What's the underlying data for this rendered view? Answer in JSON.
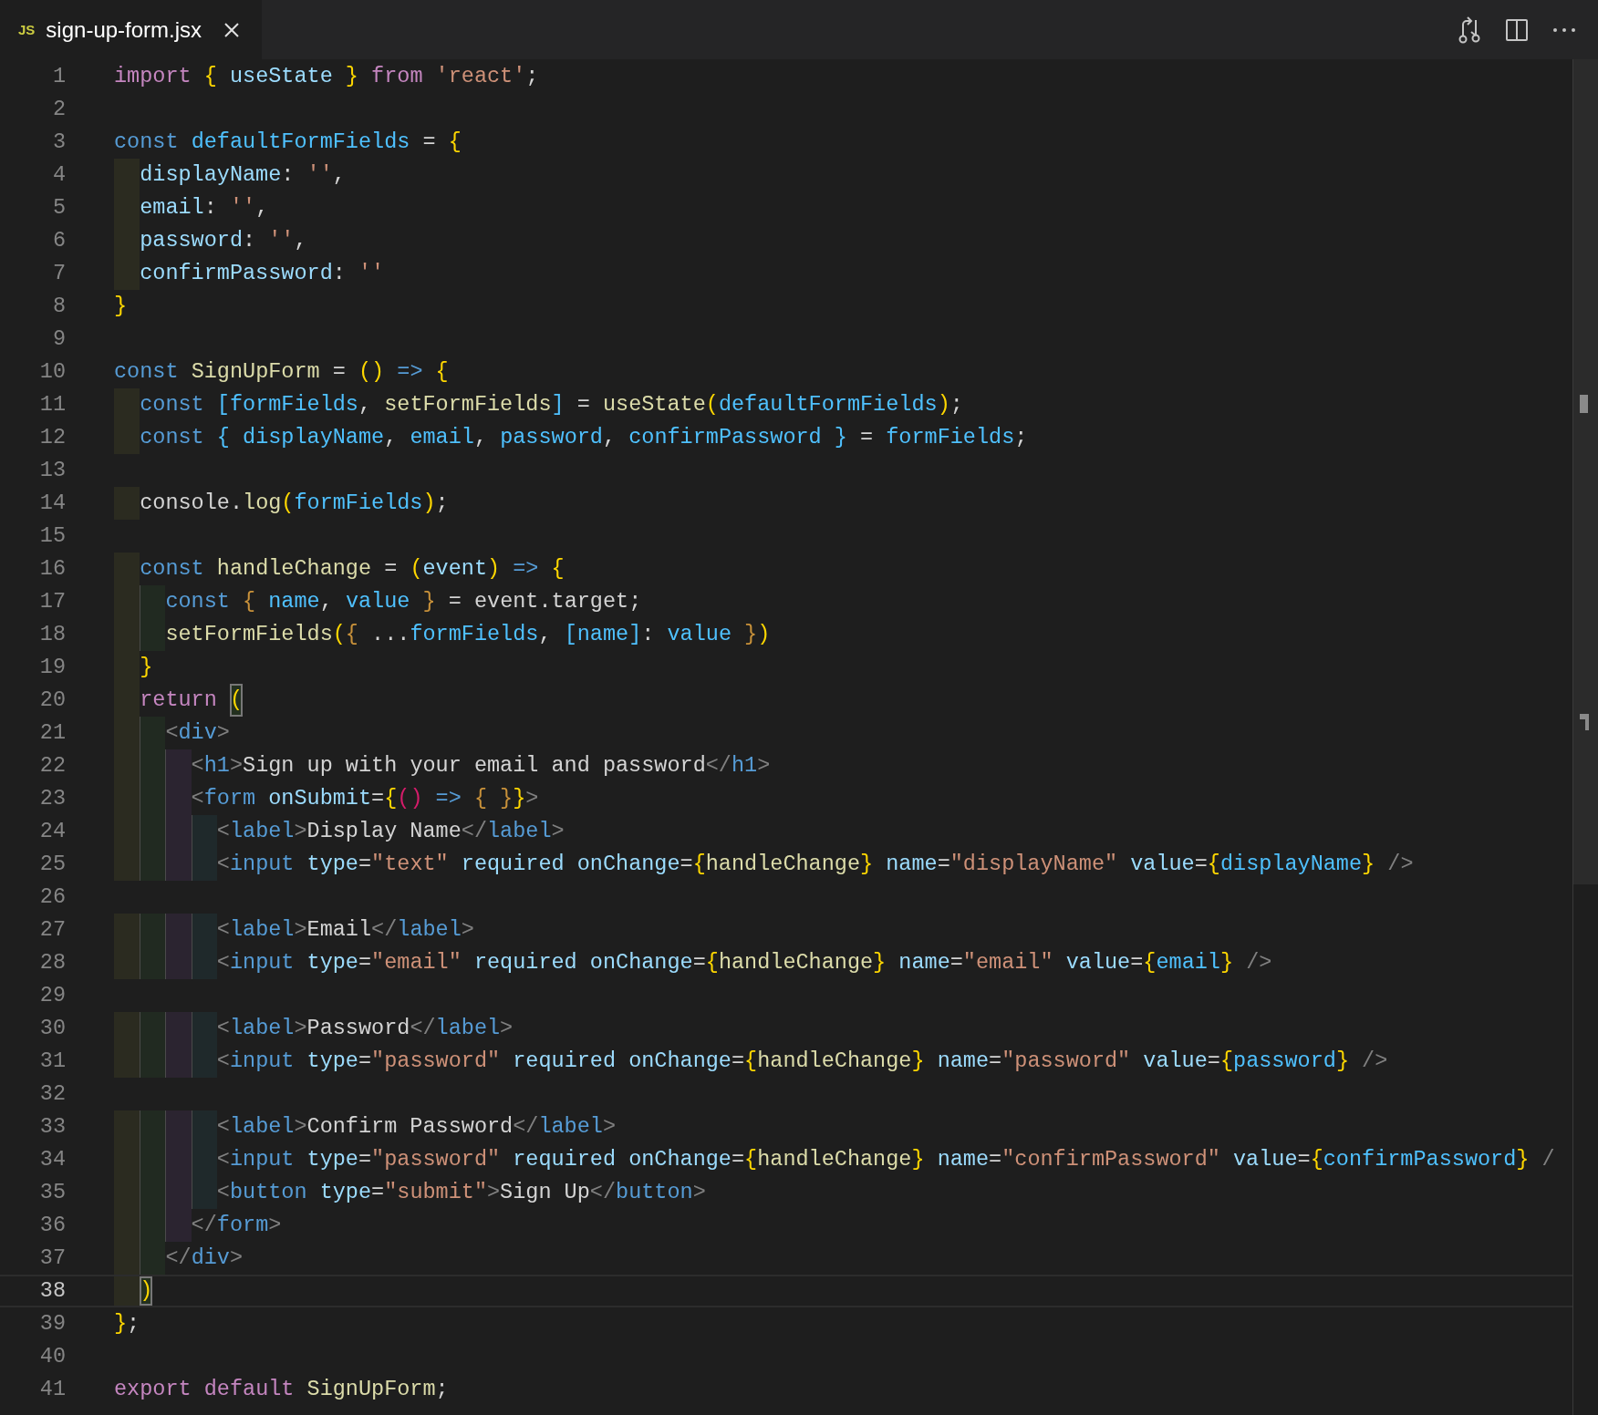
{
  "tab": {
    "icon_text": "JS",
    "label": "sign-up-form.jsx",
    "selected": true
  },
  "lines": [
    {
      "number": "1",
      "current": false,
      "tokens": [
        {
          "kind": "kw",
          "text": "import "
        },
        {
          "kind": "b1",
          "text": "{ "
        },
        {
          "kind": "var",
          "text": "useState "
        },
        {
          "kind": "b1",
          "text": "} "
        },
        {
          "kind": "kw",
          "text": "from "
        },
        {
          "kind": "str",
          "text": "'react'"
        },
        {
          "kind": "p",
          "text": ";"
        }
      ]
    },
    {
      "number": "2",
      "current": false
    },
    {
      "number": "3",
      "current": false,
      "tokens": [
        {
          "kind": "st",
          "text": "const "
        },
        {
          "kind": "const",
          "text": "defaultFormFields "
        },
        {
          "kind": "p",
          "text": "= "
        },
        {
          "kind": "b1",
          "text": "{"
        }
      ]
    },
    {
      "number": "4",
      "current": false,
      "tokens": [
        {
          "kind": "var",
          "text": "  displayName"
        },
        {
          "kind": "p",
          "text": ": "
        },
        {
          "kind": "str",
          "text": "''"
        },
        {
          "kind": "p",
          "text": ","
        }
      ]
    },
    {
      "number": "5",
      "current": false,
      "tokens": [
        {
          "kind": "var",
          "text": "  email"
        },
        {
          "kind": "p",
          "text": ": "
        },
        {
          "kind": "str",
          "text": "''"
        },
        {
          "kind": "p",
          "text": ","
        }
      ]
    },
    {
      "number": "6",
      "current": false,
      "tokens": [
        {
          "kind": "var",
          "text": "  password"
        },
        {
          "kind": "p",
          "text": ": "
        },
        {
          "kind": "str",
          "text": "''"
        },
        {
          "kind": "p",
          "text": ","
        }
      ]
    },
    {
      "number": "7",
      "current": false,
      "tokens": [
        {
          "kind": "var",
          "text": "  confirmPassword"
        },
        {
          "kind": "p",
          "text": ": "
        },
        {
          "kind": "str",
          "text": "''"
        }
      ]
    },
    {
      "number": "8",
      "current": false,
      "tokens": [
        {
          "kind": "b1",
          "text": "}"
        }
      ]
    },
    {
      "number": "9",
      "current": false
    },
    {
      "number": "10",
      "current": false,
      "tokens": [
        {
          "kind": "st",
          "text": "const "
        },
        {
          "kind": "fn",
          "text": "SignUpForm "
        },
        {
          "kind": "p",
          "text": "= "
        },
        {
          "kind": "b1",
          "text": "() "
        },
        {
          "kind": "st",
          "text": "=> "
        },
        {
          "kind": "b1",
          "text": "{"
        }
      ]
    },
    {
      "number": "11",
      "current": false,
      "tokens": [
        {
          "kind": "st",
          "text": "  const "
        },
        {
          "kind": "const",
          "text": "[formFields"
        },
        {
          "kind": "p",
          "text": ", "
        },
        {
          "kind": "fn",
          "text": "setFormFields"
        },
        {
          "kind": "const",
          "text": "]"
        },
        {
          "kind": "p",
          "text": " = "
        },
        {
          "kind": "fn",
          "text": "useState"
        },
        {
          "kind": "b1",
          "text": "("
        },
        {
          "kind": "const",
          "text": "defaultFormFields"
        },
        {
          "kind": "b1",
          "text": ")"
        },
        {
          "kind": "p",
          "text": ";"
        }
      ]
    },
    {
      "number": "12",
      "current": false,
      "tokens": [
        {
          "kind": "st",
          "text": "  const "
        },
        {
          "kind": "const",
          "text": "{ displayName"
        },
        {
          "kind": "p",
          "text": ", "
        },
        {
          "kind": "const",
          "text": "email"
        },
        {
          "kind": "p",
          "text": ", "
        },
        {
          "kind": "const",
          "text": "password"
        },
        {
          "kind": "p",
          "text": ", "
        },
        {
          "kind": "const",
          "text": "confirmPassword }"
        },
        {
          "kind": "p",
          "text": " = "
        },
        {
          "kind": "const",
          "text": "formFields"
        },
        {
          "kind": "p",
          "text": ";"
        }
      ]
    },
    {
      "number": "13",
      "current": false
    },
    {
      "number": "14",
      "current": false,
      "tokens": [
        {
          "kind": "p",
          "text": "  console."
        },
        {
          "kind": "fn",
          "text": "log"
        },
        {
          "kind": "b1",
          "text": "("
        },
        {
          "kind": "const",
          "text": "formFields"
        },
        {
          "kind": "b1",
          "text": ")"
        },
        {
          "kind": "p",
          "text": ";"
        }
      ]
    },
    {
      "number": "15",
      "current": false
    },
    {
      "number": "16",
      "current": false,
      "tokens": [
        {
          "kind": "st",
          "text": "  const "
        },
        {
          "kind": "fn",
          "text": "handleChange "
        },
        {
          "kind": "p",
          "text": "= "
        },
        {
          "kind": "b1",
          "text": "("
        },
        {
          "kind": "var",
          "text": "event"
        },
        {
          "kind": "b1",
          "text": ") "
        },
        {
          "kind": "st",
          "text": "=> "
        },
        {
          "kind": "b1",
          "text": "{"
        }
      ]
    },
    {
      "number": "17",
      "current": false,
      "tokens": [
        {
          "kind": "st",
          "text": "    const "
        },
        {
          "kind": "b3",
          "text": "{ "
        },
        {
          "kind": "const",
          "text": "name"
        },
        {
          "kind": "p",
          "text": ", "
        },
        {
          "kind": "const",
          "text": "value "
        },
        {
          "kind": "b3",
          "text": "}"
        },
        {
          "kind": "p",
          "text": " = event.target;"
        }
      ]
    },
    {
      "number": "18",
      "current": false,
      "tokens": [
        {
          "kind": "fn",
          "text": "    setFormFields"
        },
        {
          "kind": "b1",
          "text": "("
        },
        {
          "kind": "b3",
          "text": "{ "
        },
        {
          "kind": "p",
          "text": "..."
        },
        {
          "kind": "const",
          "text": "formFields"
        },
        {
          "kind": "p",
          "text": ", "
        },
        {
          "kind": "const",
          "text": "[name]"
        },
        {
          "kind": "p",
          "text": ": "
        },
        {
          "kind": "const",
          "text": "value "
        },
        {
          "kind": "b3",
          "text": "}"
        },
        {
          "kind": "b1",
          "text": ")"
        }
      ]
    },
    {
      "number": "19",
      "current": false,
      "tokens": [
        {
          "kind": "b1",
          "text": "  }"
        }
      ]
    },
    {
      "number": "20",
      "current": false,
      "tokens": [
        {
          "kind": "kw",
          "text": "  return "
        },
        {
          "kind": "b1",
          "text": "(",
          "matched": true
        }
      ]
    },
    {
      "number": "21",
      "current": false,
      "tokens": [
        {
          "kind": "tp",
          "text": "    <"
        },
        {
          "kind": "tag",
          "text": "div"
        },
        {
          "kind": "tp",
          "text": ">"
        }
      ]
    },
    {
      "number": "22",
      "current": false,
      "tokens": [
        {
          "kind": "tp",
          "text": "      <"
        },
        {
          "kind": "tag",
          "text": "h1"
        },
        {
          "kind": "tp",
          "text": ">"
        },
        {
          "kind": "p",
          "text": "Sign up with your email and password"
        },
        {
          "kind": "tp",
          "text": "</"
        },
        {
          "kind": "tag",
          "text": "h1"
        },
        {
          "kind": "tp",
          "text": ">"
        }
      ]
    },
    {
      "number": "23",
      "current": false,
      "tokens": [
        {
          "kind": "tp",
          "text": "      <"
        },
        {
          "kind": "tag",
          "text": "form "
        },
        {
          "kind": "var",
          "text": "onSubmit"
        },
        {
          "kind": "p",
          "text": "="
        },
        {
          "kind": "b1",
          "text": "{"
        },
        {
          "kind": "b2",
          "text": "() "
        },
        {
          "kind": "st",
          "text": "=> "
        },
        {
          "kind": "b3",
          "text": "{ }"
        },
        {
          "kind": "b1",
          "text": "}"
        },
        {
          "kind": "tp",
          "text": ">"
        }
      ]
    },
    {
      "number": "24",
      "current": false,
      "tokens": [
        {
          "kind": "tp",
          "text": "        <"
        },
        {
          "kind": "tag",
          "text": "label"
        },
        {
          "kind": "tp",
          "text": ">"
        },
        {
          "kind": "p",
          "text": "Display Name"
        },
        {
          "kind": "tp",
          "text": "</"
        },
        {
          "kind": "tag",
          "text": "label"
        },
        {
          "kind": "tp",
          "text": ">"
        }
      ]
    },
    {
      "number": "25",
      "current": false,
      "tokens": [
        {
          "kind": "tp",
          "text": "        <"
        },
        {
          "kind": "tag",
          "text": "input "
        },
        {
          "kind": "var",
          "text": "type"
        },
        {
          "kind": "p",
          "text": "="
        },
        {
          "kind": "str",
          "text": "\"text\" "
        },
        {
          "kind": "var",
          "text": "required onChange"
        },
        {
          "kind": "p",
          "text": "="
        },
        {
          "kind": "b1",
          "text": "{"
        },
        {
          "kind": "fn",
          "text": "handleChange"
        },
        {
          "kind": "b1",
          "text": "} "
        },
        {
          "kind": "var",
          "text": "name"
        },
        {
          "kind": "p",
          "text": "="
        },
        {
          "kind": "str",
          "text": "\"displayName\" "
        },
        {
          "kind": "var",
          "text": "value"
        },
        {
          "kind": "p",
          "text": "="
        },
        {
          "kind": "b1",
          "text": "{"
        },
        {
          "kind": "const",
          "text": "displayName"
        },
        {
          "kind": "b1",
          "text": "} "
        },
        {
          "kind": "tp",
          "text": "/>"
        }
      ]
    },
    {
      "number": "26",
      "current": false
    },
    {
      "number": "27",
      "current": false,
      "tokens": [
        {
          "kind": "tp",
          "text": "        <"
        },
        {
          "kind": "tag",
          "text": "label"
        },
        {
          "kind": "tp",
          "text": ">"
        },
        {
          "kind": "p",
          "text": "Email"
        },
        {
          "kind": "tp",
          "text": "</"
        },
        {
          "kind": "tag",
          "text": "label"
        },
        {
          "kind": "tp",
          "text": ">"
        }
      ]
    },
    {
      "number": "28",
      "current": false,
      "tokens": [
        {
          "kind": "tp",
          "text": "        <"
        },
        {
          "kind": "tag",
          "text": "input "
        },
        {
          "kind": "var",
          "text": "type"
        },
        {
          "kind": "p",
          "text": "="
        },
        {
          "kind": "str",
          "text": "\"email\" "
        },
        {
          "kind": "var",
          "text": "required onChange"
        },
        {
          "kind": "p",
          "text": "="
        },
        {
          "kind": "b1",
          "text": "{"
        },
        {
          "kind": "fn",
          "text": "handleChange"
        },
        {
          "kind": "b1",
          "text": "} "
        },
        {
          "kind": "var",
          "text": "name"
        },
        {
          "kind": "p",
          "text": "="
        },
        {
          "kind": "str",
          "text": "\"email\" "
        },
        {
          "kind": "var",
          "text": "value"
        },
        {
          "kind": "p",
          "text": "="
        },
        {
          "kind": "b1",
          "text": "{"
        },
        {
          "kind": "const",
          "text": "email"
        },
        {
          "kind": "b1",
          "text": "} "
        },
        {
          "kind": "tp",
          "text": "/>"
        }
      ]
    },
    {
      "number": "29",
      "current": false
    },
    {
      "number": "30",
      "current": false,
      "tokens": [
        {
          "kind": "tp",
          "text": "        <"
        },
        {
          "kind": "tag",
          "text": "label"
        },
        {
          "kind": "tp",
          "text": ">"
        },
        {
          "kind": "p",
          "text": "Password"
        },
        {
          "kind": "tp",
          "text": "</"
        },
        {
          "kind": "tag",
          "text": "label"
        },
        {
          "kind": "tp",
          "text": ">"
        }
      ]
    },
    {
      "number": "31",
      "current": false,
      "tokens": [
        {
          "kind": "tp",
          "text": "        <"
        },
        {
          "kind": "tag",
          "text": "input "
        },
        {
          "kind": "var",
          "text": "type"
        },
        {
          "kind": "p",
          "text": "="
        },
        {
          "kind": "str",
          "text": "\"password\" "
        },
        {
          "kind": "var",
          "text": "required onChange"
        },
        {
          "kind": "p",
          "text": "="
        },
        {
          "kind": "b1",
          "text": "{"
        },
        {
          "kind": "fn",
          "text": "handleChange"
        },
        {
          "kind": "b1",
          "text": "} "
        },
        {
          "kind": "var",
          "text": "name"
        },
        {
          "kind": "p",
          "text": "="
        },
        {
          "kind": "str",
          "text": "\"password\" "
        },
        {
          "kind": "var",
          "text": "value"
        },
        {
          "kind": "p",
          "text": "="
        },
        {
          "kind": "b1",
          "text": "{"
        },
        {
          "kind": "const",
          "text": "password"
        },
        {
          "kind": "b1",
          "text": "} "
        },
        {
          "kind": "tp",
          "text": "/>"
        }
      ]
    },
    {
      "number": "32",
      "current": false
    },
    {
      "number": "33",
      "current": false,
      "tokens": [
        {
          "kind": "tp",
          "text": "        <"
        },
        {
          "kind": "tag",
          "text": "label"
        },
        {
          "kind": "tp",
          "text": ">"
        },
        {
          "kind": "p",
          "text": "Confirm Password"
        },
        {
          "kind": "tp",
          "text": "</"
        },
        {
          "kind": "tag",
          "text": "label"
        },
        {
          "kind": "tp",
          "text": ">"
        }
      ]
    },
    {
      "number": "34",
      "current": false,
      "tokens": [
        {
          "kind": "tp",
          "text": "        <"
        },
        {
          "kind": "tag",
          "text": "input "
        },
        {
          "kind": "var",
          "text": "type"
        },
        {
          "kind": "p",
          "text": "="
        },
        {
          "kind": "str",
          "text": "\"password\" "
        },
        {
          "kind": "var",
          "text": "required onChange"
        },
        {
          "kind": "p",
          "text": "="
        },
        {
          "kind": "b1",
          "text": "{"
        },
        {
          "kind": "fn",
          "text": "handleChange"
        },
        {
          "kind": "b1",
          "text": "} "
        },
        {
          "kind": "var",
          "text": "name"
        },
        {
          "kind": "p",
          "text": "="
        },
        {
          "kind": "str",
          "text": "\"confirmPassword\" "
        },
        {
          "kind": "var",
          "text": "value"
        },
        {
          "kind": "p",
          "text": "="
        },
        {
          "kind": "b1",
          "text": "{"
        },
        {
          "kind": "const",
          "text": "confirmPassword"
        },
        {
          "kind": "b1",
          "text": "} "
        },
        {
          "kind": "tp",
          "text": "/"
        }
      ]
    },
    {
      "number": "35",
      "current": false,
      "tokens": [
        {
          "kind": "tp",
          "text": "        <"
        },
        {
          "kind": "tag",
          "text": "button "
        },
        {
          "kind": "var",
          "text": "type"
        },
        {
          "kind": "p",
          "text": "="
        },
        {
          "kind": "str",
          "text": "\"submit\""
        },
        {
          "kind": "tp",
          "text": ">"
        },
        {
          "kind": "p",
          "text": "Sign Up"
        },
        {
          "kind": "tp",
          "text": "</"
        },
        {
          "kind": "tag",
          "text": "button"
        },
        {
          "kind": "tp",
          "text": ">"
        }
      ]
    },
    {
      "number": "36",
      "current": false,
      "tokens": [
        {
          "kind": "tp",
          "text": "      </"
        },
        {
          "kind": "tag",
          "text": "form"
        },
        {
          "kind": "tp",
          "text": ">"
        }
      ]
    },
    {
      "number": "37",
      "current": false,
      "tokens": [
        {
          "kind": "tp",
          "text": "    </"
        },
        {
          "kind": "tag",
          "text": "div"
        },
        {
          "kind": "tp",
          "text": ">"
        }
      ]
    },
    {
      "number": "38",
      "current": true,
      "tokens": [
        {
          "kind": "b1",
          "text": "  )",
          "matched": true
        }
      ]
    },
    {
      "number": "39",
      "current": false,
      "tokens": [
        {
          "kind": "b1",
          "text": "}"
        },
        {
          "kind": "p",
          "text": ";"
        }
      ]
    },
    {
      "number": "40",
      "current": false
    },
    {
      "number": "41",
      "current": false,
      "tokens": [
        {
          "kind": "kw",
          "text": "export default "
        },
        {
          "kind": "fn",
          "text": "SignUpForm"
        },
        {
          "kind": "p",
          "text": ";"
        }
      ]
    }
  ]
}
